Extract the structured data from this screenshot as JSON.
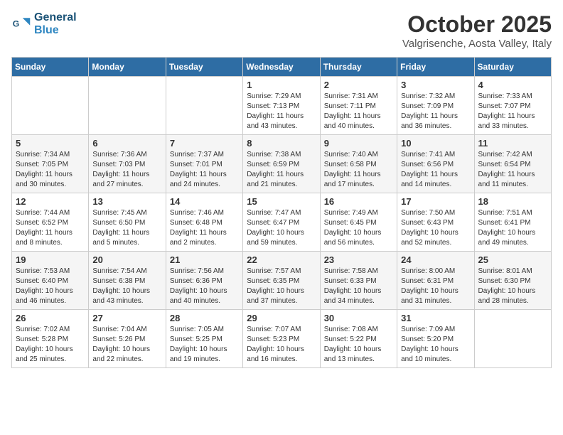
{
  "header": {
    "logo_line1": "General",
    "logo_line2": "Blue",
    "month_title": "October 2025",
    "location": "Valgrisenche, Aosta Valley, Italy"
  },
  "days_of_week": [
    "Sunday",
    "Monday",
    "Tuesday",
    "Wednesday",
    "Thursday",
    "Friday",
    "Saturday"
  ],
  "weeks": [
    [
      {
        "day": "",
        "info": ""
      },
      {
        "day": "",
        "info": ""
      },
      {
        "day": "",
        "info": ""
      },
      {
        "day": "1",
        "info": "Sunrise: 7:29 AM\nSunset: 7:13 PM\nDaylight: 11 hours\nand 43 minutes."
      },
      {
        "day": "2",
        "info": "Sunrise: 7:31 AM\nSunset: 7:11 PM\nDaylight: 11 hours\nand 40 minutes."
      },
      {
        "day": "3",
        "info": "Sunrise: 7:32 AM\nSunset: 7:09 PM\nDaylight: 11 hours\nand 36 minutes."
      },
      {
        "day": "4",
        "info": "Sunrise: 7:33 AM\nSunset: 7:07 PM\nDaylight: 11 hours\nand 33 minutes."
      }
    ],
    [
      {
        "day": "5",
        "info": "Sunrise: 7:34 AM\nSunset: 7:05 PM\nDaylight: 11 hours\nand 30 minutes."
      },
      {
        "day": "6",
        "info": "Sunrise: 7:36 AM\nSunset: 7:03 PM\nDaylight: 11 hours\nand 27 minutes."
      },
      {
        "day": "7",
        "info": "Sunrise: 7:37 AM\nSunset: 7:01 PM\nDaylight: 11 hours\nand 24 minutes."
      },
      {
        "day": "8",
        "info": "Sunrise: 7:38 AM\nSunset: 6:59 PM\nDaylight: 11 hours\nand 21 minutes."
      },
      {
        "day": "9",
        "info": "Sunrise: 7:40 AM\nSunset: 6:58 PM\nDaylight: 11 hours\nand 17 minutes."
      },
      {
        "day": "10",
        "info": "Sunrise: 7:41 AM\nSunset: 6:56 PM\nDaylight: 11 hours\nand 14 minutes."
      },
      {
        "day": "11",
        "info": "Sunrise: 7:42 AM\nSunset: 6:54 PM\nDaylight: 11 hours\nand 11 minutes."
      }
    ],
    [
      {
        "day": "12",
        "info": "Sunrise: 7:44 AM\nSunset: 6:52 PM\nDaylight: 11 hours\nand 8 minutes."
      },
      {
        "day": "13",
        "info": "Sunrise: 7:45 AM\nSunset: 6:50 PM\nDaylight: 11 hours\nand 5 minutes."
      },
      {
        "day": "14",
        "info": "Sunrise: 7:46 AM\nSunset: 6:48 PM\nDaylight: 11 hours\nand 2 minutes."
      },
      {
        "day": "15",
        "info": "Sunrise: 7:47 AM\nSunset: 6:47 PM\nDaylight: 10 hours\nand 59 minutes."
      },
      {
        "day": "16",
        "info": "Sunrise: 7:49 AM\nSunset: 6:45 PM\nDaylight: 10 hours\nand 56 minutes."
      },
      {
        "day": "17",
        "info": "Sunrise: 7:50 AM\nSunset: 6:43 PM\nDaylight: 10 hours\nand 52 minutes."
      },
      {
        "day": "18",
        "info": "Sunrise: 7:51 AM\nSunset: 6:41 PM\nDaylight: 10 hours\nand 49 minutes."
      }
    ],
    [
      {
        "day": "19",
        "info": "Sunrise: 7:53 AM\nSunset: 6:40 PM\nDaylight: 10 hours\nand 46 minutes."
      },
      {
        "day": "20",
        "info": "Sunrise: 7:54 AM\nSunset: 6:38 PM\nDaylight: 10 hours\nand 43 minutes."
      },
      {
        "day": "21",
        "info": "Sunrise: 7:56 AM\nSunset: 6:36 PM\nDaylight: 10 hours\nand 40 minutes."
      },
      {
        "day": "22",
        "info": "Sunrise: 7:57 AM\nSunset: 6:35 PM\nDaylight: 10 hours\nand 37 minutes."
      },
      {
        "day": "23",
        "info": "Sunrise: 7:58 AM\nSunset: 6:33 PM\nDaylight: 10 hours\nand 34 minutes."
      },
      {
        "day": "24",
        "info": "Sunrise: 8:00 AM\nSunset: 6:31 PM\nDaylight: 10 hours\nand 31 minutes."
      },
      {
        "day": "25",
        "info": "Sunrise: 8:01 AM\nSunset: 6:30 PM\nDaylight: 10 hours\nand 28 minutes."
      }
    ],
    [
      {
        "day": "26",
        "info": "Sunrise: 7:02 AM\nSunset: 5:28 PM\nDaylight: 10 hours\nand 25 minutes."
      },
      {
        "day": "27",
        "info": "Sunrise: 7:04 AM\nSunset: 5:26 PM\nDaylight: 10 hours\nand 22 minutes."
      },
      {
        "day": "28",
        "info": "Sunrise: 7:05 AM\nSunset: 5:25 PM\nDaylight: 10 hours\nand 19 minutes."
      },
      {
        "day": "29",
        "info": "Sunrise: 7:07 AM\nSunset: 5:23 PM\nDaylight: 10 hours\nand 16 minutes."
      },
      {
        "day": "30",
        "info": "Sunrise: 7:08 AM\nSunset: 5:22 PM\nDaylight: 10 hours\nand 13 minutes."
      },
      {
        "day": "31",
        "info": "Sunrise: 7:09 AM\nSunset: 5:20 PM\nDaylight: 10 hours\nand 10 minutes."
      },
      {
        "day": "",
        "info": ""
      }
    ]
  ]
}
